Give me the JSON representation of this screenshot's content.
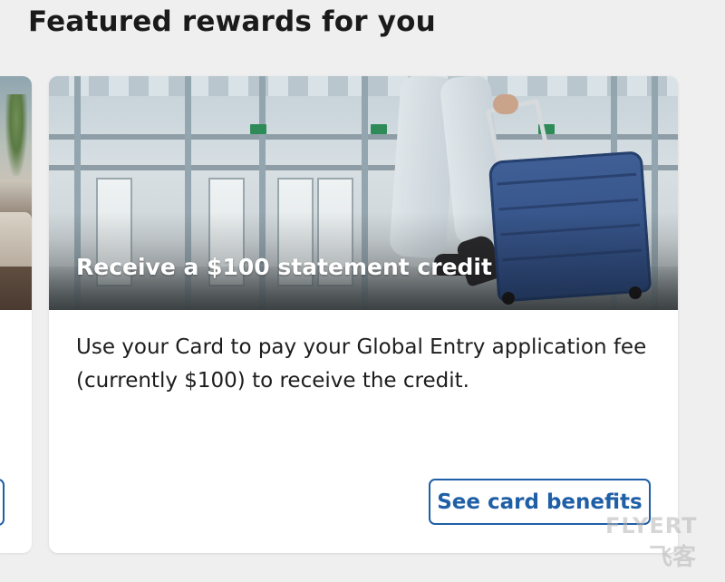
{
  "section": {
    "title": "Featured rewards for you"
  },
  "featured_card": {
    "headline": "Receive a $100 statement credit",
    "body": "Use your Card to pay your Global Entry application fee (currently $100) to receive the credit.",
    "button_label": "See card benefits"
  },
  "watermark": {
    "line1": "FLYERT",
    "line2": "飞客"
  },
  "colors": {
    "accent": "#1f5fa6",
    "background": "#efefef",
    "card": "#ffffff",
    "text": "#1d1d1d"
  }
}
